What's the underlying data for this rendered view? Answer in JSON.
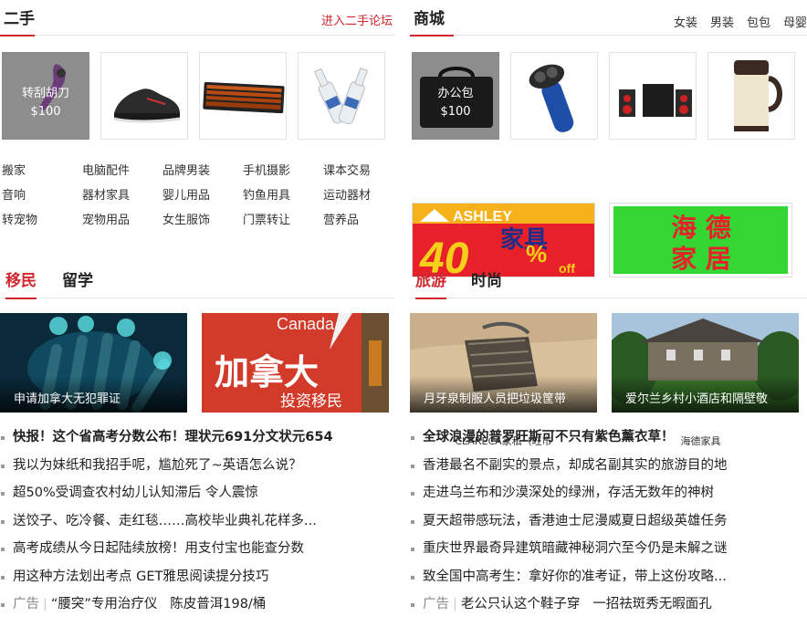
{
  "ershou": {
    "title": "二手",
    "link": "进入二手论坛",
    "featured": {
      "name": "转刮胡刀",
      "price": "$100"
    },
    "tags": [
      [
        "搬家",
        "电脑配件",
        "品牌男装",
        "手机摄影",
        "课本交易"
      ],
      [
        "音响",
        "器材家具",
        "婴儿用品",
        "钓鱼用具",
        "运动器材"
      ],
      [
        "转宠物",
        "宠物用品",
        "女生服饰",
        "门票转让",
        "营养品"
      ]
    ]
  },
  "mall": {
    "title": "商城",
    "categories": [
      "女装",
      "男装",
      "包包",
      "母婴"
    ],
    "featured": {
      "name": "办公包",
      "price": "$100"
    },
    "ads": [
      {
        "brand": "ASHLEY",
        "line1": "家具",
        "big": "40",
        "pct": "%",
        "off": "off",
        "caption": "CLARECA家私（旺市"
      },
      {
        "line1": "海 德",
        "line2": "家 居",
        "caption": "海德家具"
      }
    ]
  },
  "immigration": {
    "tabs": [
      "移民",
      "留学"
    ],
    "photos": [
      {
        "caption": "申请加拿大无犯罪证"
      },
      {
        "caption": "",
        "sign_top": "Canada",
        "sign_main": "加拿大",
        "sign_sub": "投资移民"
      }
    ],
    "news": [
      "快报！这个省高考分数公布！理状元691分文状元654",
      "我以为妹纸和我招手呢，尴尬死了~英语怎么说？",
      "超50%受调查农村幼儿认知滞后 令人震惊",
      "送饺子、吃冷餐、走红毯……高校毕业典礼花样多...",
      "高考成绩从今日起陆续放榜！用支付宝也能查分数",
      "用这种方法划出考点 GET雅思阅读提分技巧"
    ],
    "ad_row": {
      "tag": "广告",
      "a": "“腰突”专用治疗仪",
      "b": "陈皮普洱198/桶"
    }
  },
  "travel": {
    "tabs": [
      "旅游",
      "时尚"
    ],
    "photos": [
      {
        "caption": "月牙泉制服人员把垃圾筐带"
      },
      {
        "caption": "爱尔兰乡村小酒店和隔壁敬"
      }
    ],
    "news": [
      "全球浪漫的普罗旺斯可不只有紫色薰衣草！",
      "香港最名不副实的景点，却成名副其实的旅游目的地",
      "走进乌兰布和沙漠深处的绿洲，存活无数年的神树",
      "夏天超带感玩法，香港迪士尼漫威夏日超级英雄任务",
      "重庆世界最奇异建筑暗藏神秘洞穴至今仍是未解之谜",
      "致全国中高考生：拿好你的准考证，带上这份攻略..."
    ],
    "ad_row": {
      "tag": "广告",
      "a": "老公只认这个鞋子穿",
      "b": "一招祛斑秀无暇面孔"
    }
  },
  "colors": {
    "accent": "#d0282e",
    "ad_red": "#e8202a",
    "ad_green": "#33d633"
  }
}
